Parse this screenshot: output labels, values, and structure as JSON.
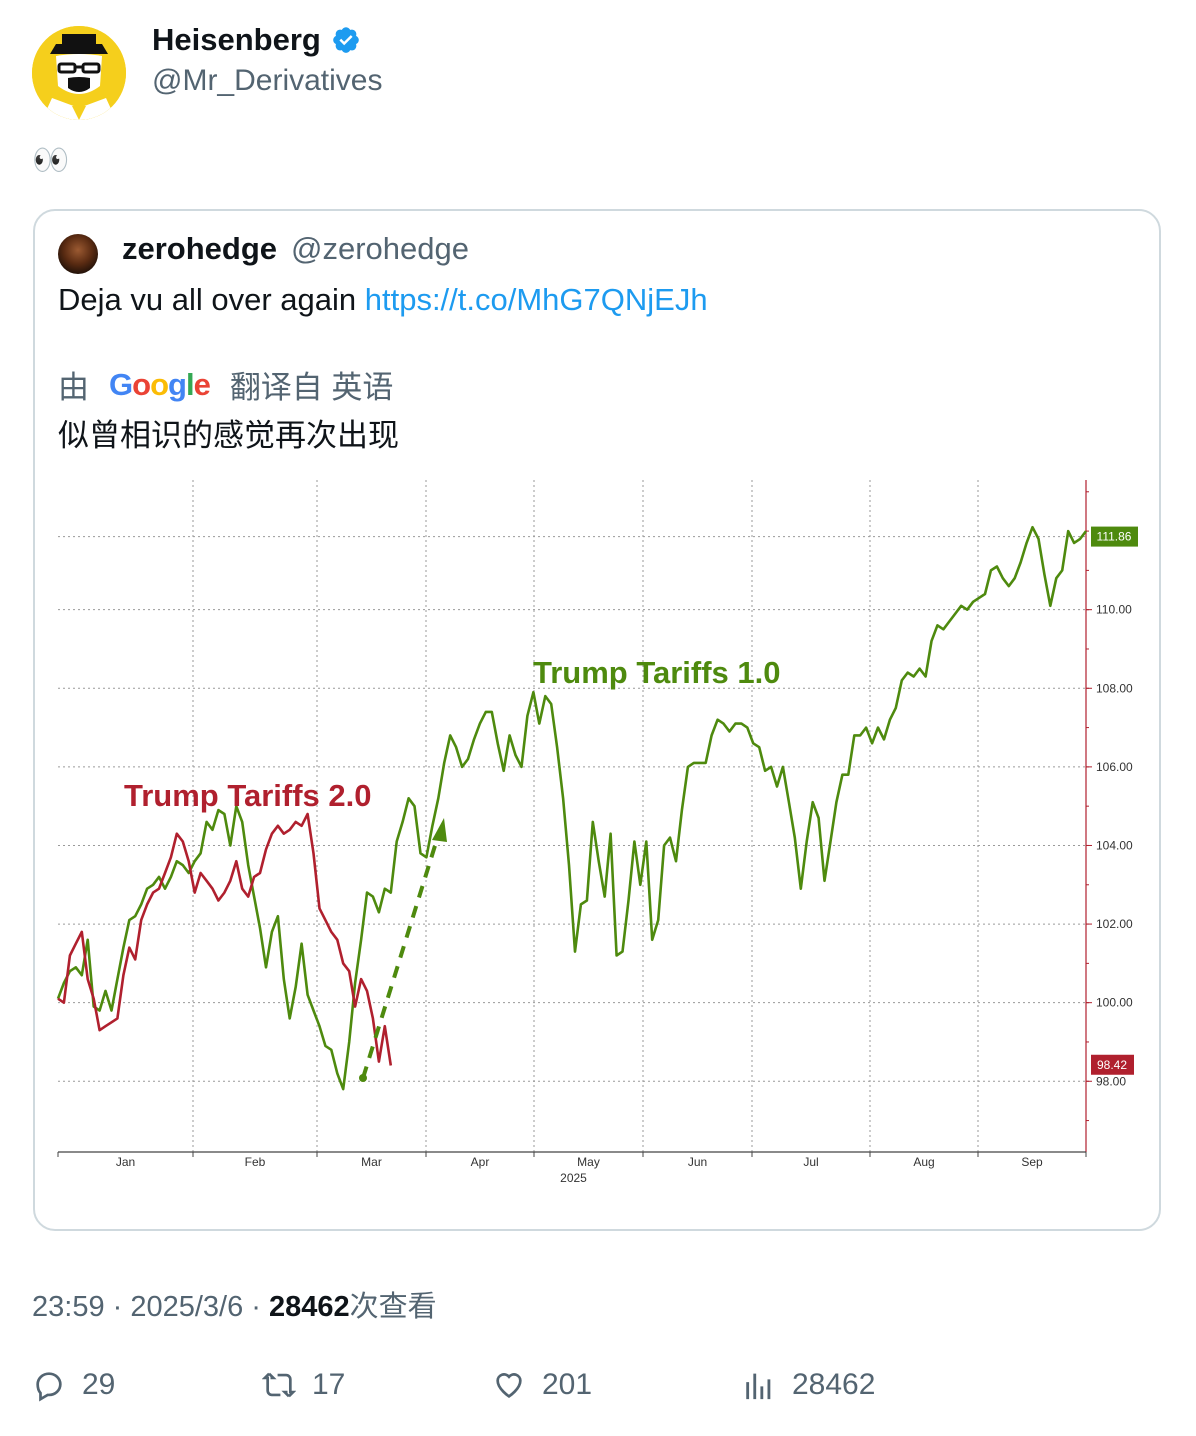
{
  "author": {
    "name": "Heisenberg",
    "handle": "@Mr_Derivatives",
    "verified": true
  },
  "tweet_text": "👀",
  "quoted": {
    "name": "zerohedge",
    "handle": "@zerohedge",
    "text": "Deja vu all over again ",
    "link": "https://t.co/MhG7QNjEJh",
    "translate_prefix": "由",
    "translate_brand": "Google",
    "translate_suffix": "翻译自 英语",
    "translated_text": "似曾相识的感觉再次出现"
  },
  "chart_data": {
    "type": "line",
    "x_labels": [
      "Jan",
      "Feb",
      "Mar",
      "Apr",
      "May",
      "Jun",
      "Jul",
      "Aug",
      "Sep"
    ],
    "year_label": "2025",
    "y_ticks": [
      "98.00",
      "100.00",
      "102.00",
      "104.00",
      "106.00",
      "108.00",
      "110.00"
    ],
    "ylim": [
      96.2,
      113.3
    ],
    "annotations": [
      "Trump Tariffs 2.0",
      "Trump Tariffs 1.0"
    ],
    "series": [
      {
        "name": "Trump Tariffs 1.0",
        "color": "#4e8a0e",
        "last_value": "111.86",
        "values": [
          100.1,
          100.5,
          100.8,
          100.9,
          100.7,
          101.6,
          99.9,
          99.8,
          100.3,
          99.8,
          100.6,
          101.4,
          102.1,
          102.2,
          102.5,
          102.9,
          103.0,
          103.2,
          102.9,
          103.2,
          103.6,
          103.5,
          103.3,
          103.6,
          103.8,
          104.6,
          104.4,
          104.9,
          104.8,
          104.0,
          105.0,
          104.6,
          103.5,
          102.7,
          101.9,
          100.9,
          101.8,
          102.2,
          100.6,
          99.6,
          100.4,
          101.5,
          100.2,
          99.8,
          99.4,
          98.9,
          98.8,
          98.2,
          97.8,
          99.0,
          100.5,
          101.6,
          102.8,
          102.7,
          102.3,
          102.9,
          102.8,
          104.1,
          104.6,
          105.2,
          105.0,
          103.8,
          103.7,
          104.5,
          105.2,
          106.1,
          106.8,
          106.5,
          106.0,
          106.2,
          106.7,
          107.1,
          107.4,
          107.4,
          106.6,
          105.9,
          106.8,
          106.3,
          106.0,
          107.3,
          107.9,
          107.1,
          107.8,
          107.6,
          106.5,
          105.2,
          103.5,
          101.3,
          102.5,
          102.6,
          104.6,
          103.6,
          102.7,
          104.3,
          101.2,
          101.3,
          102.6,
          104.1,
          103.0,
          104.1,
          101.6,
          102.1,
          104.0,
          104.2,
          103.6,
          104.9,
          106.0,
          106.1,
          106.1,
          106.1,
          106.8,
          107.2,
          107.1,
          106.9,
          107.1,
          107.1,
          107.0,
          106.6,
          106.5,
          105.9,
          106.0,
          105.5,
          106.0,
          105.1,
          104.2,
          102.9,
          104.1,
          105.1,
          104.7,
          103.1,
          104.1,
          105.1,
          105.8,
          105.8,
          106.8,
          106.8,
          107.0,
          106.6,
          107.0,
          106.7,
          107.2,
          107.5,
          108.2,
          108.4,
          108.3,
          108.5,
          108.3,
          109.2,
          109.6,
          109.5,
          109.7,
          109.9,
          110.1,
          110.0,
          110.2,
          110.3,
          110.4,
          111.0,
          111.1,
          110.8,
          110.6,
          110.8,
          111.2,
          111.7,
          112.1,
          111.8,
          110.9,
          110.1,
          110.8,
          111.0,
          112.0,
          111.7,
          111.8,
          112.0
        ]
      },
      {
        "name": "Trump Tariffs 2.0",
        "color": "#b0202e",
        "last_value": "98.42",
        "values": [
          100.1,
          100.0,
          101.2,
          101.5,
          101.8,
          100.6,
          100.1,
          99.3,
          99.4,
          99.5,
          99.6,
          100.7,
          101.4,
          101.1,
          102.1,
          102.5,
          102.8,
          102.9,
          103.3,
          103.7,
          104.3,
          104.1,
          103.6,
          102.8,
          103.3,
          103.1,
          102.9,
          102.6,
          102.8,
          103.1,
          103.6,
          102.9,
          102.7,
          103.2,
          103.3,
          103.9,
          104.3,
          104.5,
          104.3,
          104.4,
          104.6,
          104.5,
          104.8,
          103.8,
          102.4,
          102.1,
          101.8,
          101.6,
          101.0,
          100.8,
          99.9,
          100.6,
          100.3,
          99.6,
          98.5,
          99.4,
          98.4
        ]
      }
    ]
  },
  "timestamp": "23:59 · 2025/3/6 · ",
  "views_count": "28462",
  "views_label": "次查看",
  "stats": {
    "replies": "29",
    "retweets": "17",
    "likes": "201",
    "views": "28462"
  },
  "colors": {
    "link": "#1d9bf0",
    "verified": "#1d9bf0",
    "secondary": "#536471"
  }
}
